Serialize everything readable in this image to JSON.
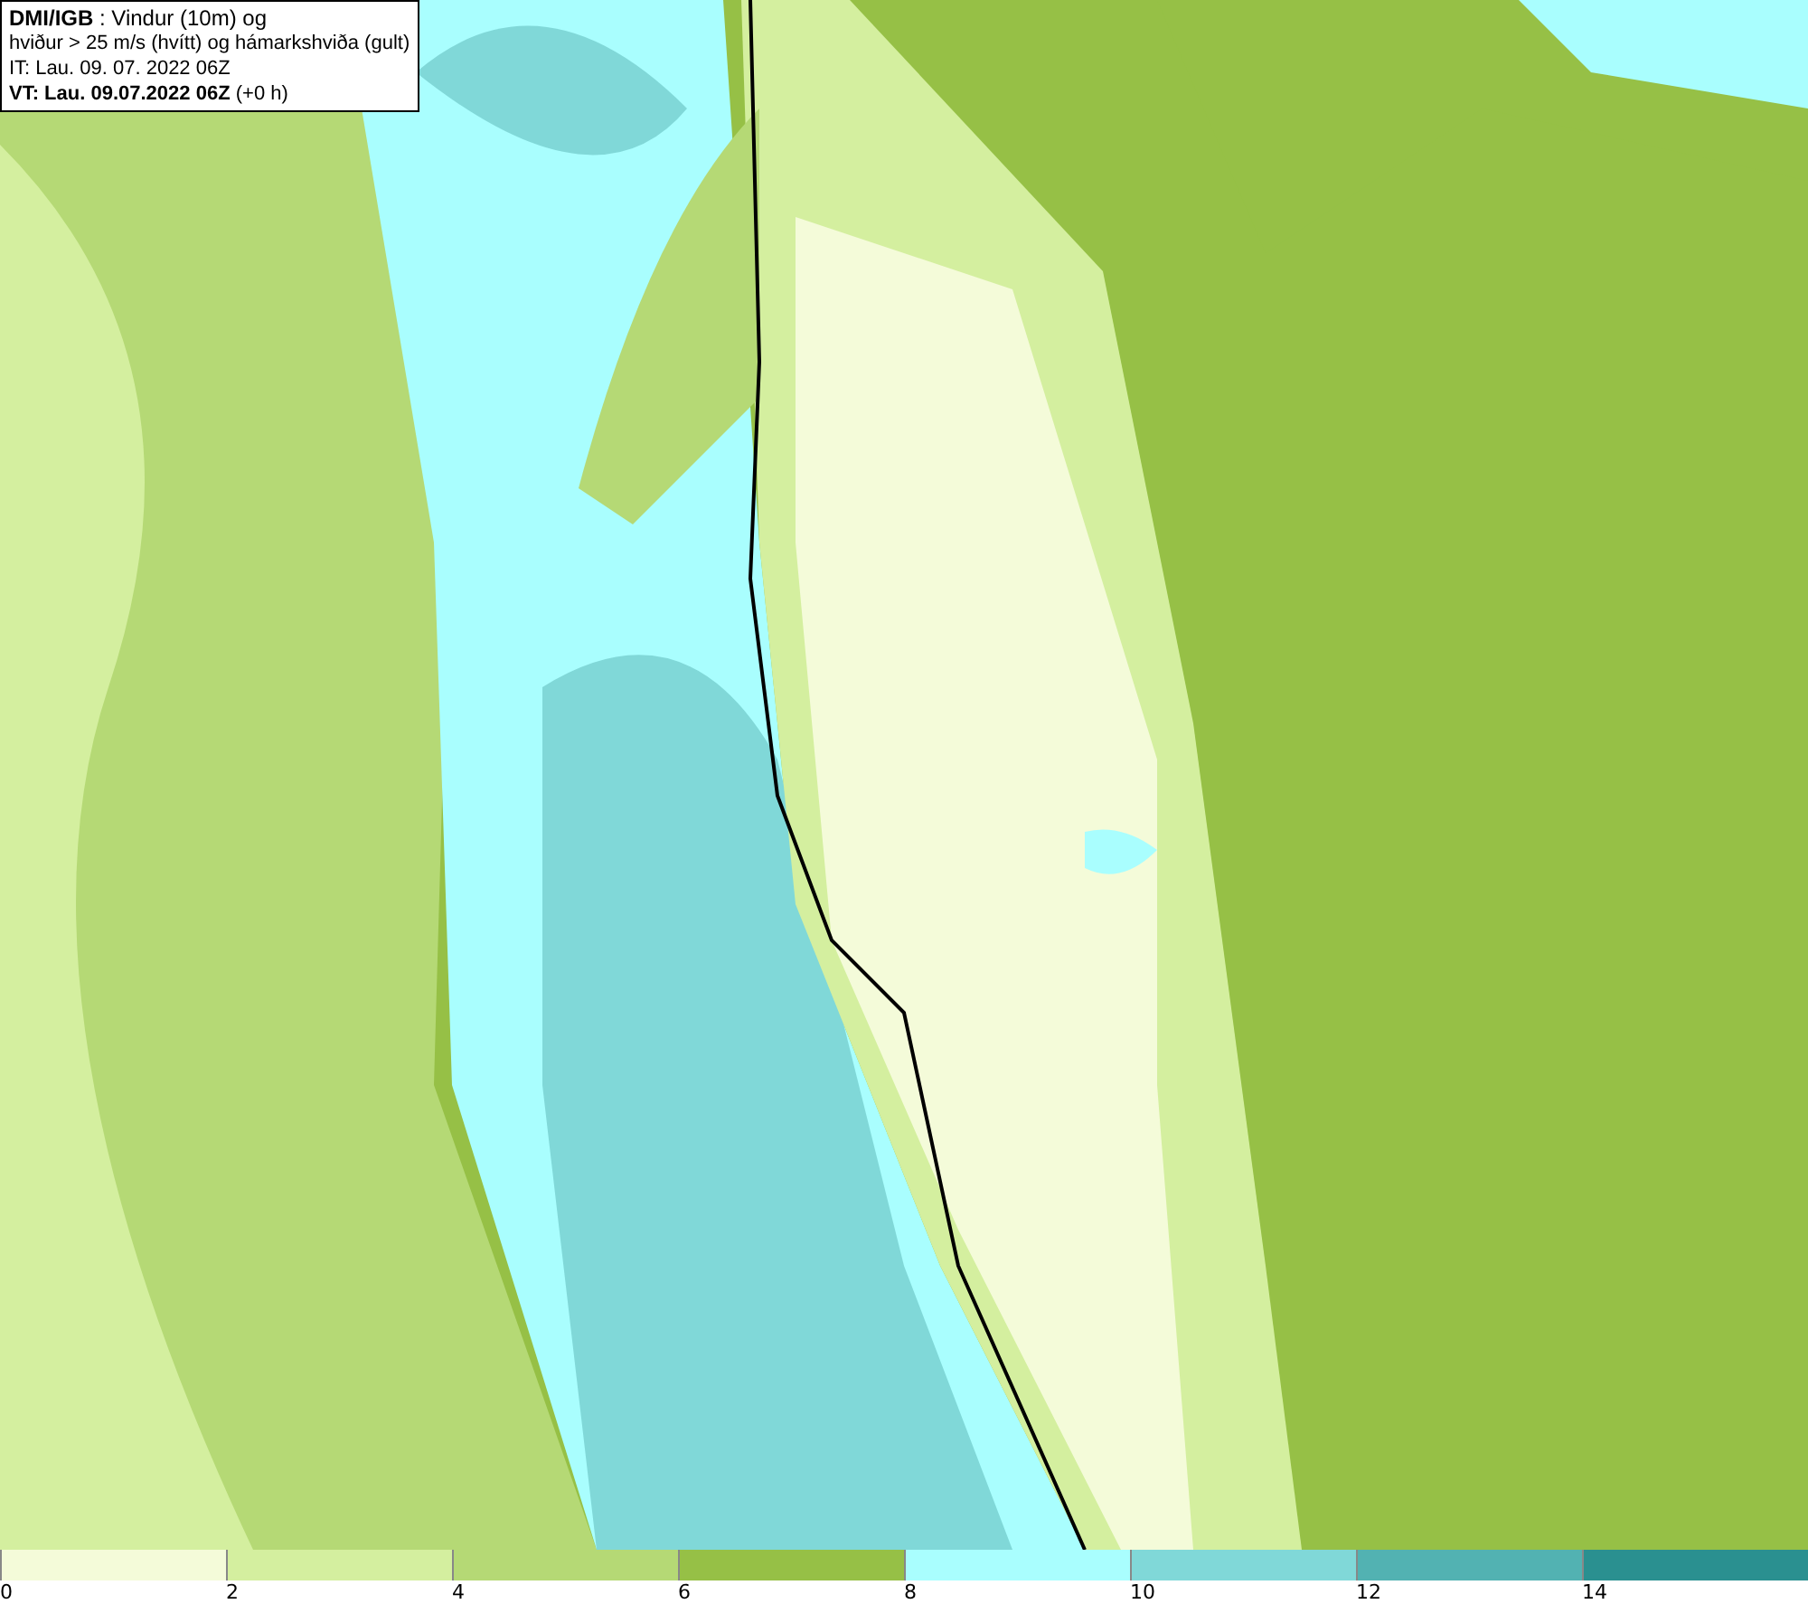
{
  "title_box": {
    "lines": [
      "**DMI/IGB** : Vindur (10m) og",
      "hviður > 25 m/s (hvítt) og hámarkshviða (gult)",
      "IT: Lau. 09. 07. 2022 06Z",
      "**VT: Lau. 09.07.2022 06Z** (+0 h)"
    ]
  },
  "legend": {
    "bins": [
      {
        "color": "#f4fbd9"
      },
      {
        "color": "#d4ef9f"
      },
      {
        "color": "#b5d975"
      },
      {
        "color": "#96c046"
      },
      {
        "color": "#a9fefe"
      },
      {
        "color": "#80d8d8"
      },
      {
        "color": "#52b2b2"
      },
      {
        "color": "#2a9090"
      }
    ],
    "ticks": [
      "0",
      "2",
      "4",
      "6",
      "8",
      "10",
      "12",
      "14"
    ]
  }
}
